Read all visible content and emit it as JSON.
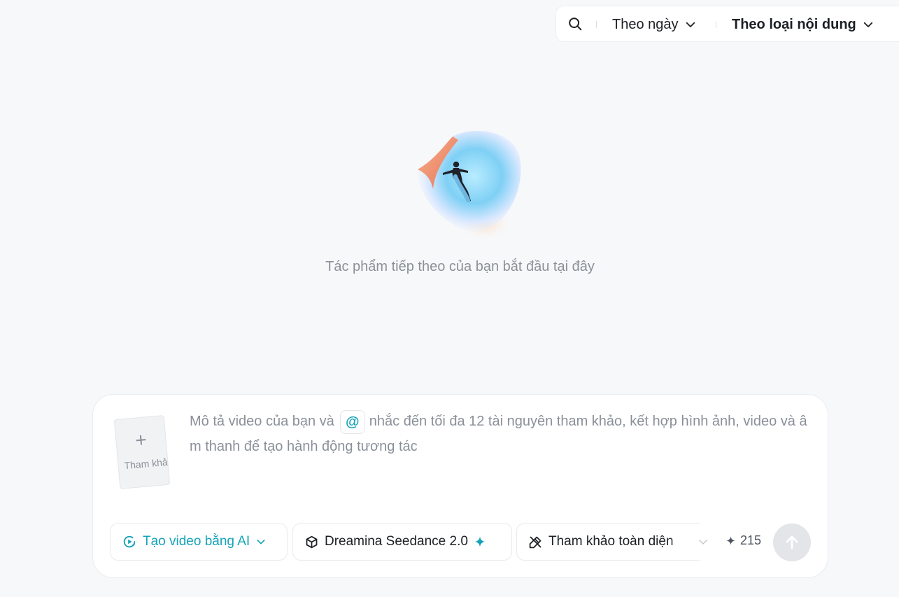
{
  "filter_bar": {
    "search_icon": "search-icon",
    "date_filter_label": "Theo ngày",
    "content_filter_label": "Theo loại nội dung"
  },
  "empty_state": {
    "message": "Tác phẩm tiếp theo của bạn bắt đầu tại đây"
  },
  "composer": {
    "reference_card": {
      "icon": "plus-icon",
      "label": "Tham khảo"
    },
    "prompt_placeholder_part1": "Mô tả video của bạn và",
    "mention_symbol": "@",
    "prompt_placeholder_part2": "nhắc đến tối đa 12 tài nguyên tham khảo, kết hợp hình ảnh, video và âm thanh để tạo hành động tương tác",
    "mode_label": "Tạo video bằng AI",
    "model_label": "Dreamina Seedance 2.0",
    "reference_mode_label": "Tham khảo toàn diện",
    "credits": "215"
  },
  "colors": {
    "accent": "#13a3b8",
    "background": "#f7f8fa",
    "muted_text": "#8a9099",
    "send_button": "#e3e5e8"
  }
}
